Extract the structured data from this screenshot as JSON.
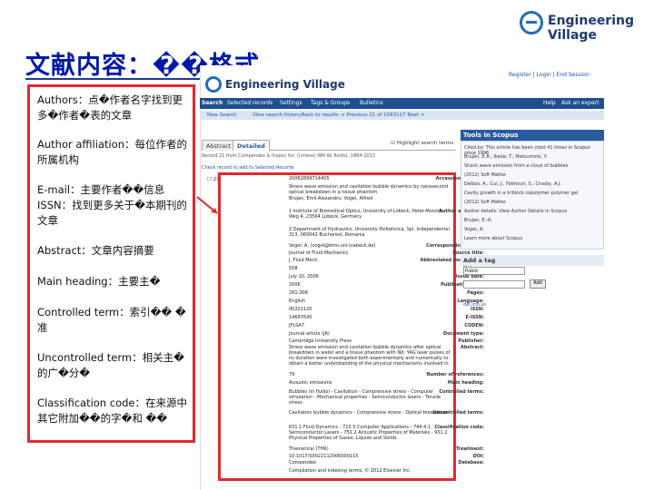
{
  "slide": {
    "title": "文献内容：��格式",
    "brand": "Engineering Village"
  },
  "notes": [
    "Authors：点�作者名字找到更多�作者�表的文章",
    "Author affiliation：每位作者的所属机构",
    "E-mail：主要作者��信息 ISSN：找到更多关于�本期刊的文章",
    "Abstract：文章内容摘要",
    "Main heading：主要主�",
    "Controlled term：索引�� �准",
    "Uncontrolled term：相关主�的广�分�",
    "Classification code：在来源中其它附加��的字�和 ��"
  ],
  "screenshot": {
    "logo_text": "Engineering Village",
    "top_links": "Register | Login | End Session",
    "nav": [
      "Search",
      "Selected records",
      "Settings",
      "Tags & Groups",
      "Bulletins",
      "Help",
      "Ask an expert"
    ],
    "subnav": [
      "New Search",
      "View search history",
      "Back to results",
      "< Previous 21 of 1093117 Next >"
    ],
    "tabs": [
      "Abstract",
      "Detailed"
    ],
    "highlight": "Highlight search terms",
    "record_line": "Record 21 from Compendex & Inspec for: ((stress) WN All fields), 1884-2012",
    "check_line": "Check record to add to Selected Records",
    "record_number": "21",
    "tools_title": "Tools in Scopus",
    "tools_lines": [
      "Cited by: This article has been cited 41 times in Scopus since 1996",
      "Brujan, E.A.; Ikeda, T.; Matsumoto, Y.",
      "Shock wave emission from a cloud of bubbles",
      "(2012) Soft Matter",
      "Delbos, A.; Cui, J.; Fakhouri, S.; Crosby, A.J.",
      "Cavity growth in a triblock copolymer polymer gel",
      "(2012) Soft Matter",
      "Author details: View Author Details in Scopus",
      "Brujan, E.-A.",
      "Vogel, A.",
      "Learn more about Scopus"
    ],
    "tag_title": "Add a tag",
    "tag_option": "Public",
    "tag_add": "Add",
    "delicious": "del.icio.us",
    "rows": [
      {
        "label": "Accession number:",
        "value": "20062899714405"
      },
      {
        "label": "Title:",
        "value": "Stress wave emission and cavitation bubble dynamics by nanosecond optical breakdown in a tissue phantom"
      },
      {
        "label": "Authors:",
        "value": "Brujan, Emil-Alexandru; Vogel, Alfred"
      },
      {
        "label": "Author affiliation:",
        "value": "1 Institute of Biomedical Optics, University of Lübeck, Peter-Monnik-Weg 4, 23564 Lübeck, Germany"
      },
      {
        "label": "",
        "value": "2 Department of Hydraulics, University Politehnica, Spl. Independentei 313, 060042 Bucharest, Romania"
      },
      {
        "label": "Corresponding author:",
        "value": "Vogel, A. (vogel@bmo.uni-luebeck.de)"
      },
      {
        "label": "Source title:",
        "value": "Journal of Fluid Mechanics"
      },
      {
        "label": "Abbreviated source title:",
        "value": "J. Fluid Mech."
      },
      {
        "label": "Volume:",
        "value": "558"
      },
      {
        "label": "Issue date:",
        "value": "July 10, 2006"
      },
      {
        "label": "Publication year:",
        "value": "2006"
      },
      {
        "label": "Pages:",
        "value": "281-308"
      },
      {
        "label": "Language:",
        "value": "English"
      },
      {
        "label": "ISSN:",
        "value": "00221120"
      },
      {
        "label": "E-ISSN:",
        "value": "14697645"
      },
      {
        "label": "CODEN:",
        "value": "JFLSA7"
      },
      {
        "label": "Document type:",
        "value": "Journal article (JA)"
      },
      {
        "label": "Publisher:",
        "value": "Cambridge University Press"
      },
      {
        "label": "Abstract:",
        "value": "Stress wave emission and cavitation bubble dynamics after optical breakdown in water and a tissue phantom with Nd: YAG laser pulses of ns duration were investigated both experimentally and numerically to obtain a better understanding of the physical mechanisms involved in"
      },
      {
        "label": "Number of references:",
        "value": "79"
      },
      {
        "label": "Main heading:",
        "value": "Acoustic emissions"
      },
      {
        "label": "Controlled terms:",
        "value": "Bubbles (in fluids) - Cavitation - Compressive stress - Computer simulation - Mechanical properties - Semiconductor lasers - Tensile stress"
      },
      {
        "label": "Uncontrolled terms:",
        "value": "Cavitation bubble dynamics - Compressive stress - Optical breakdown"
      },
      {
        "label": "Classification code:",
        "value": "631.1 Fluid Dynamics - 723.5 Computer Applications - 744.4.1 Semiconductor Lasers - 751.2 Acoustic Properties of Materials - 931.2 Physical Properties of Gases, Liquids and Solids"
      },
      {
        "label": "Treatment:",
        "value": "Theoretical (THR)"
      },
      {
        "label": "DOI:",
        "value": "10.1017/S0022112006000115"
      },
      {
        "label": "Database:",
        "value": "Compendex"
      },
      {
        "label": "",
        "value": "Compilation and indexing terms, © 2012 Elsevier Inc."
      }
    ]
  }
}
